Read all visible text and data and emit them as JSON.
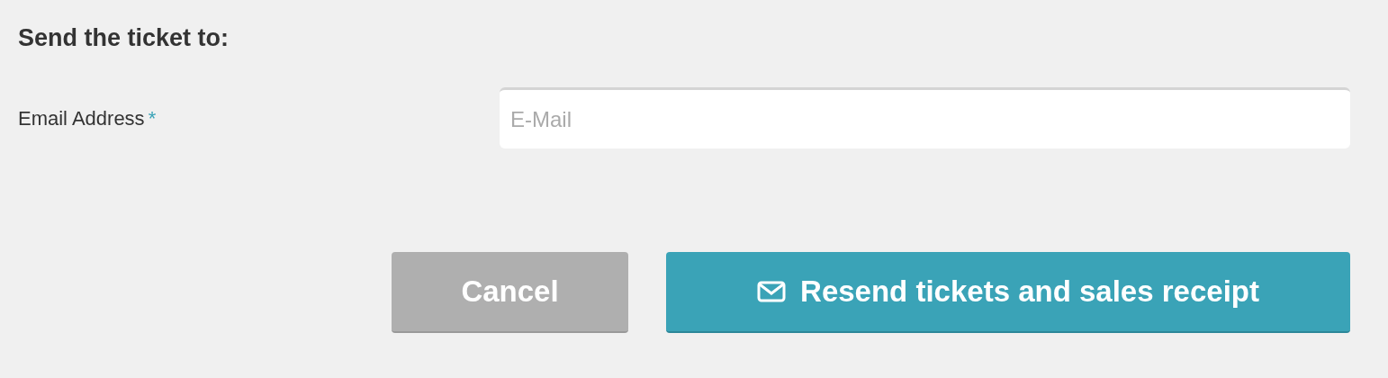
{
  "heading": "Send the ticket to:",
  "email_field": {
    "label": "Email Address",
    "required_mark": "*",
    "placeholder": "E-Mail"
  },
  "buttons": [
    {
      "kind": "cancel",
      "label": "Cancel"
    },
    {
      "kind": "resend",
      "label": "Resend tickets and sales receipt"
    }
  ]
}
